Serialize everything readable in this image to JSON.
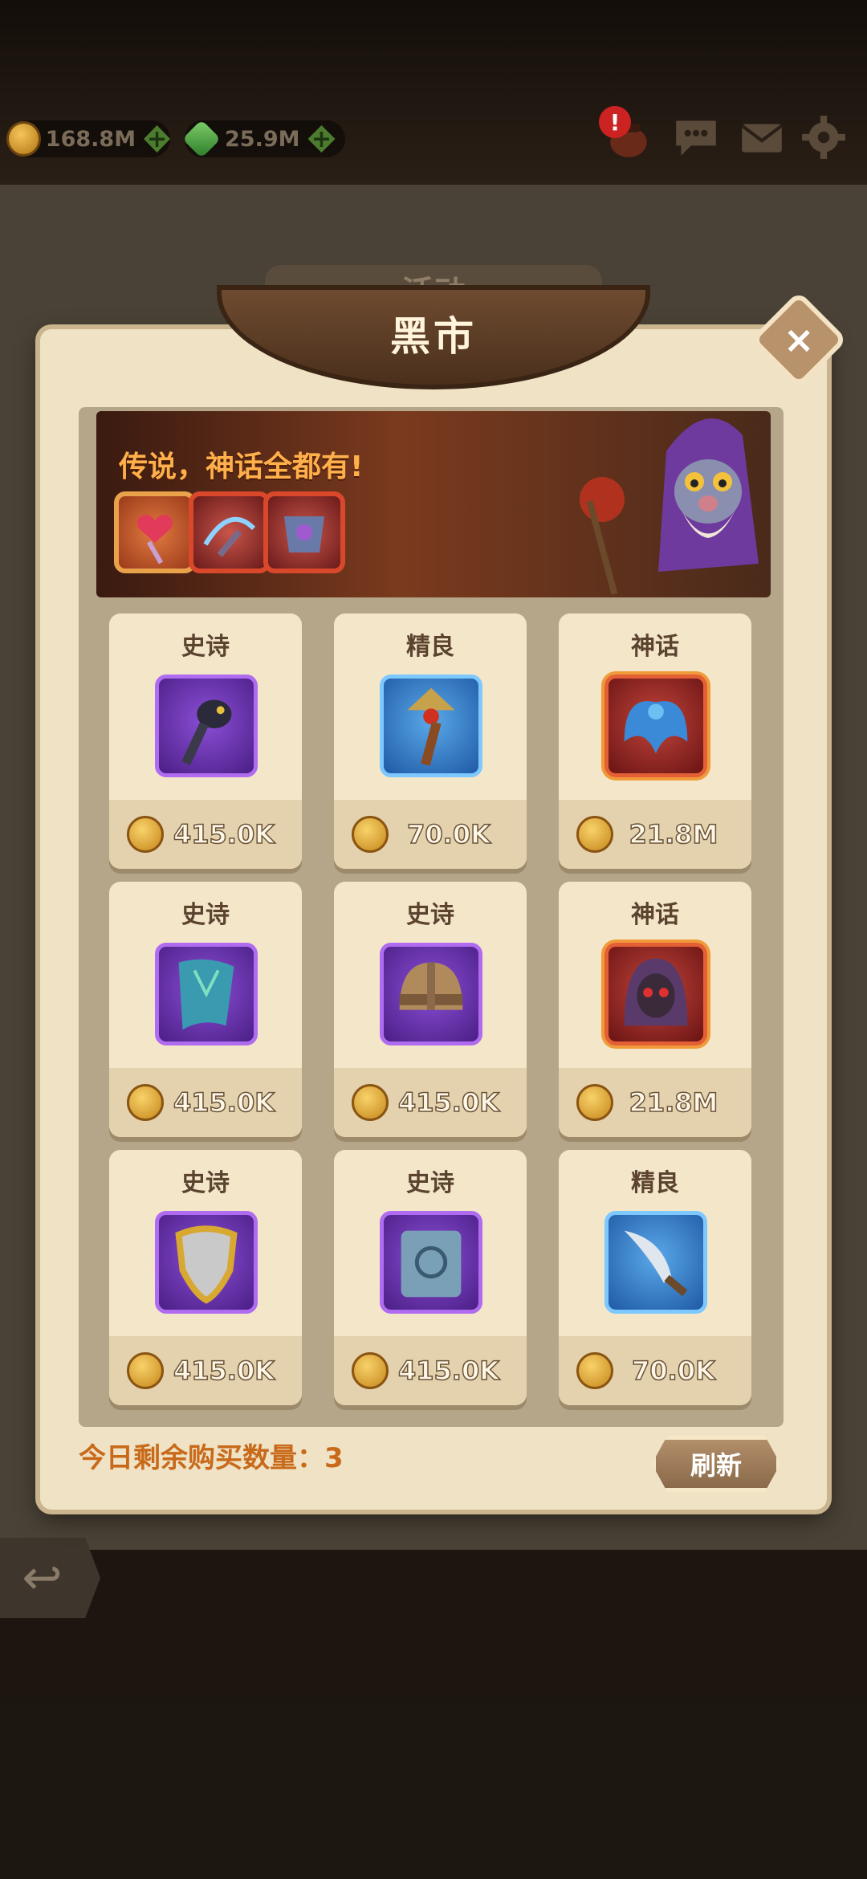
{
  "hud": {
    "gold": "168.8M",
    "gems": "25.9M",
    "alert": "!"
  },
  "background": {
    "tab_title": "活动"
  },
  "dialog": {
    "title": "黑市",
    "close_label": "×",
    "banner_text": "传说，神话全都有!",
    "remaining_label": "今日剩余购买数量：3",
    "refresh_label": "刷新"
  },
  "cards": [
    {
      "rarity": "史诗",
      "price": "415.0K",
      "item_icon": "raven-staff-icon",
      "tier": "epic"
    },
    {
      "rarity": "精良",
      "price": "70.0K",
      "item_icon": "torch-staff-icon",
      "tier": "fine"
    },
    {
      "rarity": "神话",
      "price": "21.8M",
      "item_icon": "winged-cape-icon",
      "tier": "myth"
    },
    {
      "rarity": "史诗",
      "price": "415.0K",
      "item_icon": "cloak-icon",
      "tier": "epic"
    },
    {
      "rarity": "史诗",
      "price": "415.0K",
      "item_icon": "helmet-icon",
      "tier": "epic"
    },
    {
      "rarity": "神话",
      "price": "21.8M",
      "item_icon": "skull-hood-icon",
      "tier": "myth"
    },
    {
      "rarity": "史诗",
      "price": "415.0K",
      "item_icon": "shield-icon",
      "tier": "epic"
    },
    {
      "rarity": "史诗",
      "price": "415.0K",
      "item_icon": "spellbook-icon",
      "tier": "epic"
    },
    {
      "rarity": "精良",
      "price": "70.0K",
      "item_icon": "dagger-icon",
      "tier": "fine"
    }
  ],
  "colors": {
    "epic": "#7b3fc7",
    "fine": "#2f7fd0",
    "myth": "#c0392b",
    "accent_orange": "#c86a1a"
  }
}
